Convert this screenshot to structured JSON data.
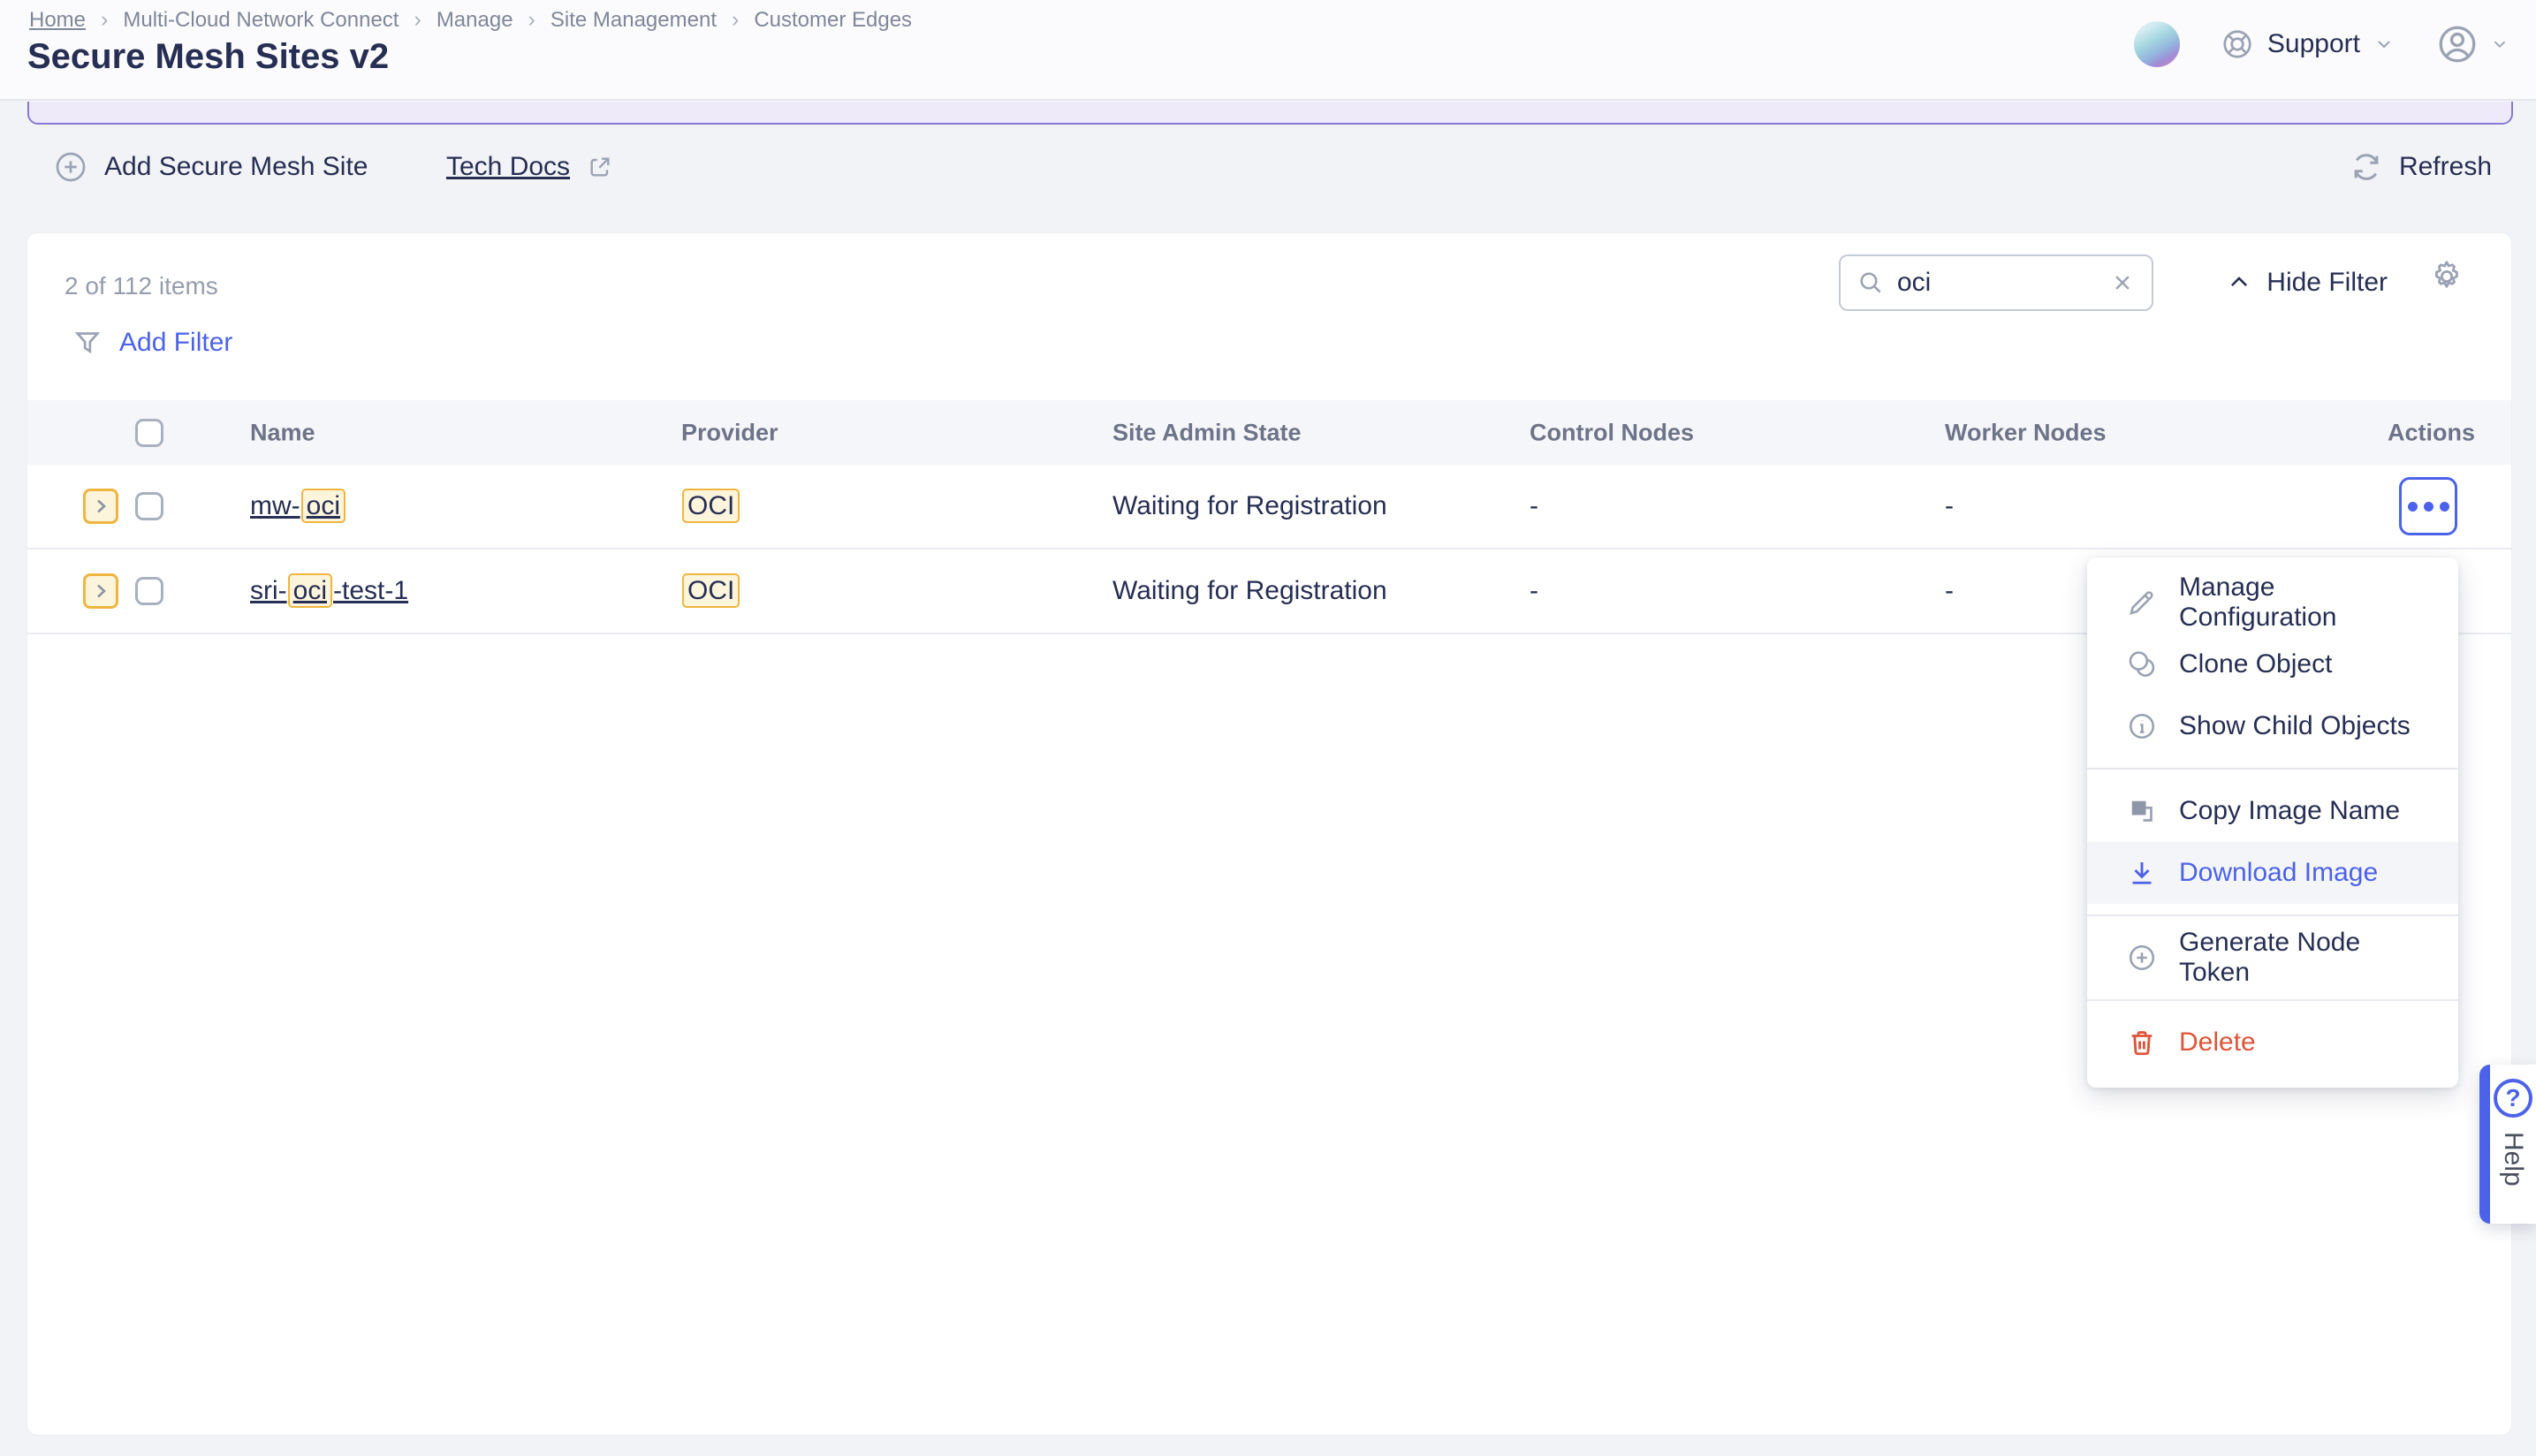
{
  "breadcrumb": {
    "items": [
      "Home",
      "Multi-Cloud Network Connect",
      "Manage",
      "Site Management",
      "Customer Edges"
    ]
  },
  "header": {
    "title": "Secure Mesh Sites v2",
    "support_label": "Support"
  },
  "toolbar": {
    "add_label": "Add Secure Mesh Site",
    "docs_label": "Tech Docs",
    "refresh_label": "Refresh"
  },
  "panel": {
    "count_text": "2 of 112 items",
    "search": {
      "value": "oci"
    },
    "hide_filter_label": "Hide Filter",
    "add_filter_label": "Add Filter"
  },
  "table": {
    "columns": [
      "Name",
      "Provider",
      "Site Admin State",
      "Control Nodes",
      "Worker Nodes",
      "Actions"
    ],
    "rows": [
      {
        "name_pre": "mw-",
        "name_match": "oci",
        "name_post": "",
        "provider": "OCI",
        "admin_state": "Waiting for Registration",
        "control_nodes": "-",
        "worker_nodes": "-"
      },
      {
        "name_pre": "sri-",
        "name_match": "oci",
        "name_post": "-test-1",
        "provider": "OCI",
        "admin_state": "Waiting for Registration",
        "control_nodes": "-",
        "worker_nodes": "-"
      }
    ]
  },
  "menu": {
    "sections": [
      {
        "items": [
          {
            "label": "Manage Configuration",
            "icon": "pencil-icon"
          },
          {
            "label": "Clone Object",
            "icon": "clone-icon"
          },
          {
            "label": "Show Child Objects",
            "icon": "info-icon"
          }
        ]
      },
      {
        "items": [
          {
            "label": "Copy Image Name",
            "icon": "copy-icon"
          },
          {
            "label": "Download Image",
            "icon": "download-icon",
            "state": "hover"
          }
        ]
      },
      {
        "items": [
          {
            "label": "Generate Node Token",
            "icon": "plus-circle-icon"
          }
        ]
      },
      {
        "items": [
          {
            "label": "Delete",
            "icon": "trash-icon",
            "state": "danger"
          }
        ]
      }
    ]
  },
  "help": {
    "label": "Help"
  },
  "colors": {
    "accent_blue": "#4c62e9",
    "danger_red": "#e0543a",
    "highlight_yellow": "#f0b53f",
    "banner_purple": "#8779d3",
    "navy_text": "#262e54"
  }
}
